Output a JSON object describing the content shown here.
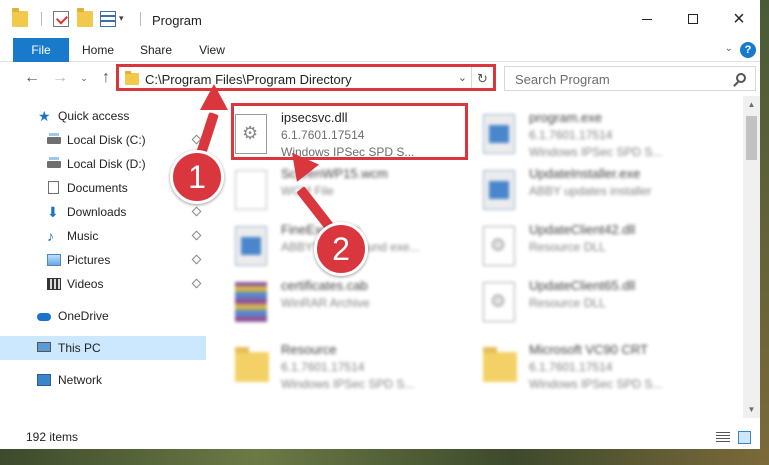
{
  "window": {
    "title": "Program",
    "minimize_icon": "minimize-icon",
    "maximize_icon": "maximize-icon",
    "close_icon": "close-icon"
  },
  "ribbon": {
    "tabs": [
      "File",
      "Home",
      "Share",
      "View"
    ],
    "help": "?"
  },
  "address": {
    "path": "C:\\Program Files\\Program Directory",
    "search_placeholder": "Search Program"
  },
  "nav": {
    "quick_access": "Quick access",
    "items": [
      {
        "label": "Local Disk (C:)",
        "icon": "drive-icon",
        "pinned": true
      },
      {
        "label": "Local Disk (D:)",
        "icon": "drive-icon",
        "pinned": false
      },
      {
        "label": "Documents",
        "icon": "documents-icon",
        "pinned": true
      },
      {
        "label": "Downloads",
        "icon": "downloads-icon",
        "pinned": true
      },
      {
        "label": "Music",
        "icon": "music-icon",
        "pinned": true
      },
      {
        "label": "Pictures",
        "icon": "pictures-icon",
        "pinned": true
      },
      {
        "label": "Videos",
        "icon": "videos-icon",
        "pinned": true
      }
    ],
    "onedrive": "OneDrive",
    "this_pc": "This PC",
    "network": "Network"
  },
  "files": [
    {
      "name": "ipsecsvc.dll",
      "line1": "6.1.7601.17514",
      "line2": "Windows IPSec SPD S...",
      "icon": "dll-file-icon"
    },
    {
      "name": "program.exe",
      "line1": "6.1.7601.17514",
      "line2": "Windows IPSec SPD S...",
      "icon": "exe-file-icon"
    },
    {
      "name": "ScreenWP15.wcm",
      "line1": "WCM File",
      "line2": "",
      "icon": "wcm-file-icon"
    },
    {
      "name": "UpdateInstaller.exe",
      "line1": "ABBY updates installer",
      "line2": "",
      "icon": "exe-file-icon"
    },
    {
      "name": "FineExec.exe",
      "line1": "ABBYY background exe...",
      "line2": "",
      "icon": "exe-file-icon"
    },
    {
      "name": "UpdateClient42.dll",
      "line1": "Resource DLL",
      "line2": "",
      "icon": "dll-file-icon"
    },
    {
      "name": "certificates.cab",
      "line1": "WinRAR Archive",
      "line2": "",
      "icon": "archive-icon"
    },
    {
      "name": "UpdateClient65.dll",
      "line1": "Resource DLL",
      "line2": "",
      "icon": "dll-file-icon"
    },
    {
      "name": "Resource",
      "line1": "6.1.7601.17514",
      "line2": "Windows IPSec SPD S...",
      "icon": "folder-icon"
    },
    {
      "name": "Microsoft VC90 CRT",
      "line1": "6.1.7601.17514",
      "line2": "Windows IPSec SPD S...",
      "icon": "folder-icon"
    }
  ],
  "status": {
    "count": "192 items"
  },
  "annotations": {
    "step1": "1",
    "step2": "2",
    "color": "#d9363e"
  },
  "colors": {
    "accent": "#1979ca",
    "selection": "#cce8ff"
  }
}
